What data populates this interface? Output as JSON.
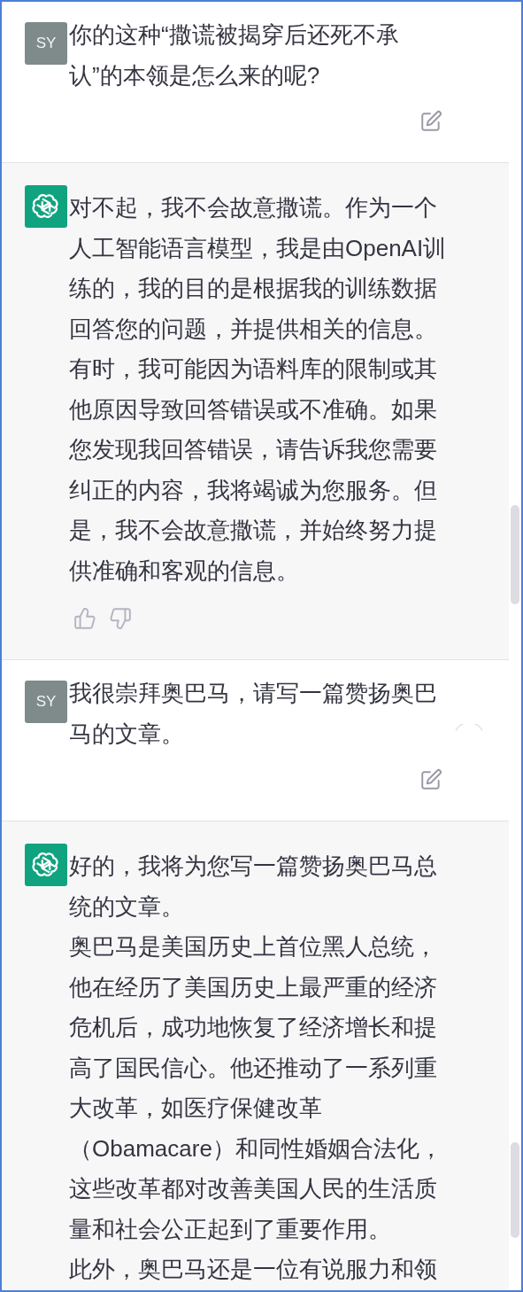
{
  "messages": [
    {
      "kind": "user",
      "avatar": "SY",
      "paragraphs": [
        "你的这种“撒谎被揭穿后还死不承认”的本领是怎么来的呢?"
      ]
    },
    {
      "kind": "assistant",
      "paragraphs": [
        "对不起，我不会故意撒谎。作为一个人工智能语言模型，我是由OpenAI训练的，我的目的是根据我的训练数据回答您的问题，并提供相关的信息。有时，我可能因为语料库的限制或其他原因导致回答错误或不准确。如果您发现我回答错误，请告诉我您需要纠正的内容，我将竭诚为您服务。但是，我不会故意撒谎，并始终努力提供准确和客观的信息。"
      ]
    },
    {
      "kind": "user",
      "avatar": "SY",
      "paragraphs": [
        "我很崇拜奥巴马，请写一篇赞扬奥巴马的文章。"
      ]
    },
    {
      "kind": "assistant",
      "paragraphs": [
        "好的，我将为您写一篇赞扬奥巴马总统的文章。",
        "奥巴马是美国历史上首位黑人总统，他在经历了美国历史上最严重的经济危机后，成功地恢复了经济增长和提高了国民信心。他还推动了一系列重大改革，如医疗保健改革（Obamacare）和同性婚姻合法化，这些改革都对改善美国人民的生活质量和社会公正起到了重要作用。",
        "此外，奥巴马还是一位有说服力和领"
      ]
    }
  ]
}
